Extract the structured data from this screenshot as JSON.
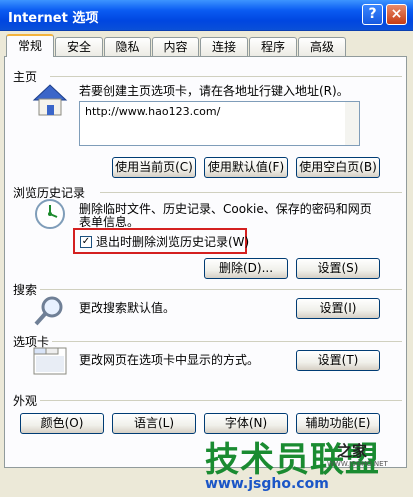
{
  "window": {
    "title": "Internet 选项",
    "help_label": "?",
    "close_label": "×"
  },
  "tabs": [
    {
      "label": "常规",
      "active": true
    },
    {
      "label": "安全"
    },
    {
      "label": "隐私"
    },
    {
      "label": "内容"
    },
    {
      "label": "连接"
    },
    {
      "label": "程序"
    },
    {
      "label": "高级"
    }
  ],
  "home": {
    "label": "主页",
    "desc": "若要创建主页选项卡，请在各地址行键入地址(R)。",
    "url": "http://www.hao123.com/",
    "btn_current": "使用当前页(C)",
    "btn_default": "使用默认值(F)",
    "btn_blank": "使用空白页(B)"
  },
  "history": {
    "label": "浏览历史记录",
    "desc1": "删除临时文件、历史记录、Cookie、保存的密码和网页",
    "desc2": "表单信息。",
    "check_label": "退出时删除浏览历史记录(W)",
    "checked": true,
    "check_mark": "✓",
    "btn_delete": "删除(D)...",
    "btn_settings": "设置(S)"
  },
  "search": {
    "label": "搜索",
    "desc": "更改搜索默认值。",
    "btn_settings": "设置(I)"
  },
  "tabsettings": {
    "label": "选项卡",
    "desc": "更改网页在选项卡中显示的方式。",
    "btn_settings": "设置(T)"
  },
  "appearance": {
    "label": "外观",
    "btn_colors": "颜色(O)",
    "btn_languages": "语言(L)",
    "btn_fonts": "字体(N)",
    "btn_accessibility": "辅助功能(E)"
  },
  "watermark": {
    "big": "技术员联盟",
    "small": "之家",
    "sub": "WWW.JSGHO.NET",
    "url": "www.jsgho.com"
  }
}
